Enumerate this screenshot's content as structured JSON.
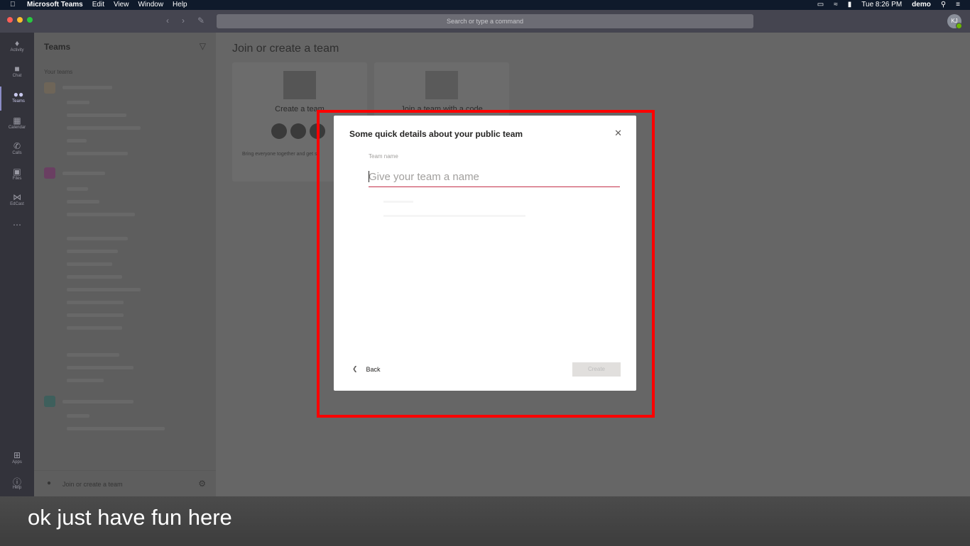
{
  "menubar": {
    "app": "Microsoft Teams",
    "items": [
      "Edit",
      "View",
      "Window",
      "Help"
    ],
    "clock": "Tue 8:26 PM",
    "user": "demo"
  },
  "titlebar": {
    "search_placeholder": "Search or type a command",
    "avatar_initials": "KJ"
  },
  "rail": {
    "items": [
      {
        "label": "Activity",
        "icon": "bell-icon"
      },
      {
        "label": "Chat",
        "icon": "chat-icon"
      },
      {
        "label": "Teams",
        "icon": "teams-icon"
      },
      {
        "label": "Calendar",
        "icon": "calendar-icon"
      },
      {
        "label": "Calls",
        "icon": "phone-icon"
      },
      {
        "label": "Files",
        "icon": "files-icon"
      },
      {
        "label": "EdCast",
        "icon": "edcast-icon"
      },
      {
        "label": "Apps",
        "icon": "apps-icon"
      },
      {
        "label": "Help",
        "icon": "help-icon"
      }
    ]
  },
  "panel": {
    "title": "Teams",
    "section": "Your teams",
    "join_label": "Join or create a team"
  },
  "main": {
    "title": "Join or create a team",
    "card_create_title": "Create a team",
    "card_create_desc": "Bring everyone together and get s",
    "card_join_title": "Join a team with a code"
  },
  "dialog": {
    "title": "Some quick details about your public team",
    "field_label": "Team name",
    "placeholder": "Give your team a name",
    "back_label": "Back",
    "create_label": "Create"
  },
  "caption": "ok just have fun here",
  "colors": {
    "highlight": "#ff0000",
    "accent": "#c4314b",
    "rail": "#33333b"
  }
}
